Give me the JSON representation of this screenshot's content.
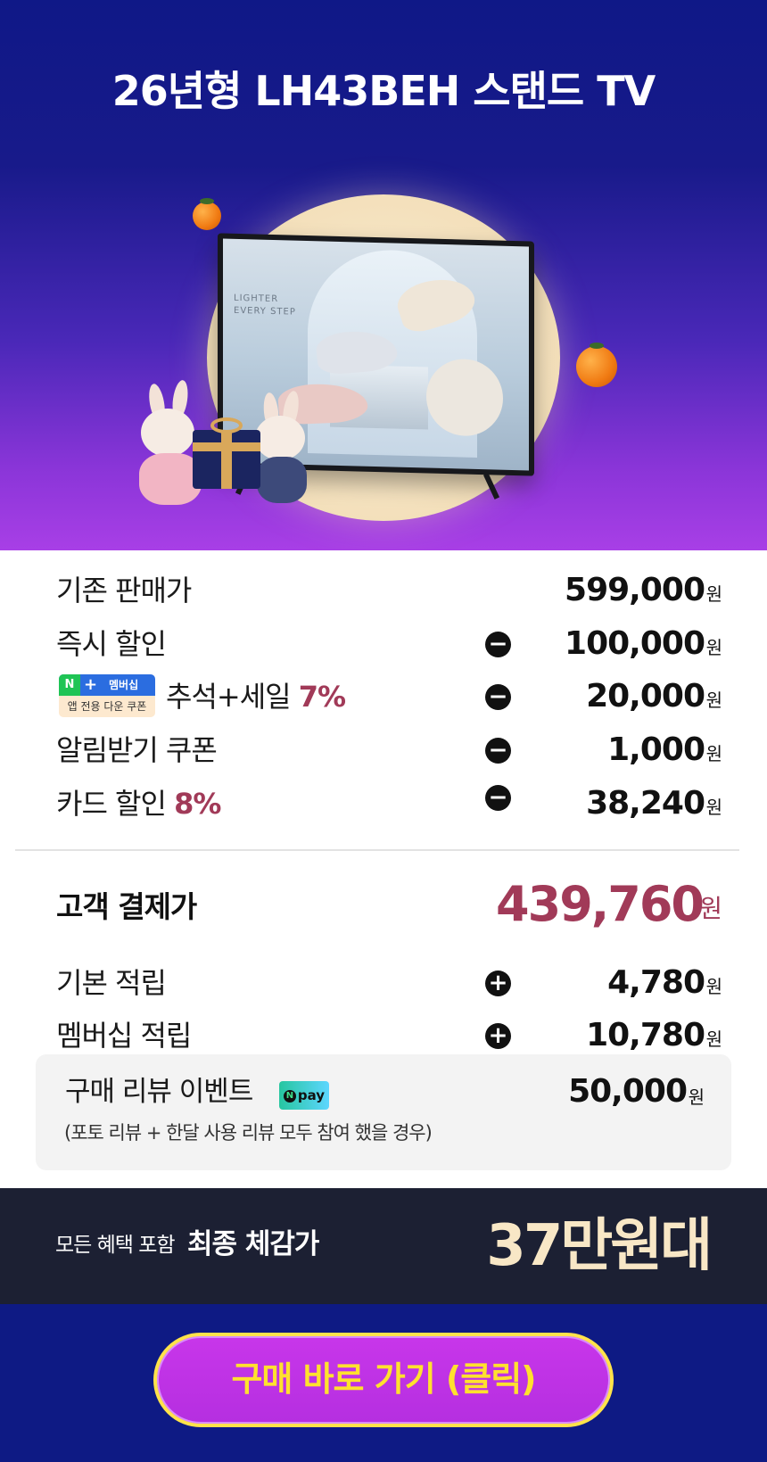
{
  "hero": {
    "title": "26년형 LH43BEH 스탠드 TV",
    "tv_text_line1": "LIGHTER",
    "tv_text_line2": "EVERY STEP"
  },
  "prices": {
    "rows": [
      {
        "label": "기존 판매가",
        "amount": "599,000",
        "unit": "원"
      },
      {
        "label": "즉시 할인",
        "sign": "−",
        "amount": "100,000",
        "unit": "원"
      },
      {
        "label": "추석+세일 ",
        "highlight": "7%",
        "sign": "−",
        "amount": "20,000",
        "unit": "원",
        "badge": {
          "n": "N",
          "plus": "+",
          "top": "멤버십",
          "bottom": "앱 전용 다운 쿠폰"
        }
      },
      {
        "label": "알림받기 쿠폰",
        "sign": "−",
        "amount": "1,000",
        "unit": "원"
      },
      {
        "label": "카드 할인 ",
        "highlight": "8%",
        "sign": "−",
        "amount": "38,240",
        "unit": "원"
      }
    ],
    "total": {
      "label": "고객 결제가",
      "amount": "439,760",
      "unit": "원"
    },
    "points": [
      {
        "label": "기본 적립",
        "sign": "+",
        "amount": "4,780",
        "unit": "원"
      },
      {
        "label": "멤버십 적립",
        "sign": "+",
        "amount": "10,780",
        "unit": "원"
      }
    ],
    "review": {
      "label": "구매 리뷰 이벤트",
      "npay_logo": "pay",
      "npay_n": "N",
      "amount": "50,000",
      "unit": "원",
      "note": "(포토 리뷰 + 한달 사용 리뷰 모두 참여 했을 경우)"
    }
  },
  "final": {
    "small": "모든 혜택 포함",
    "big": "최종 체감가",
    "value": "37만원대"
  },
  "cta": {
    "label": "구매 바로 가기 (클릭)"
  },
  "colors": {
    "accent": "#a13a58",
    "cta_text": "#ffe12e",
    "cta_bg": "#c836ea",
    "navy": "#0e1a84",
    "final_value": "#f8e7c6"
  }
}
